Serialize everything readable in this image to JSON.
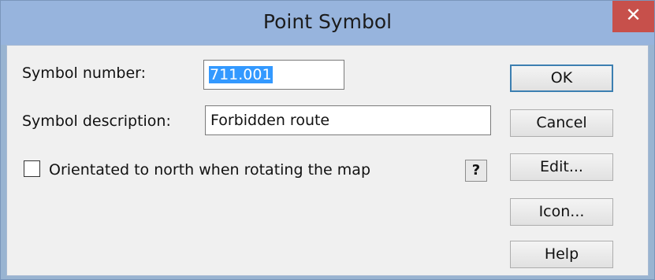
{
  "window": {
    "title": "Point Symbol",
    "close_glyph": "✕"
  },
  "form": {
    "symbol_number_label": "Symbol number:",
    "symbol_number_value": "711.001",
    "symbol_description_label": "Symbol description:",
    "symbol_description_value": "Forbidden route",
    "orientation_checkbox_label": "Orientated to north when rotating the map",
    "orientation_checked": false,
    "help_question_label": "?"
  },
  "buttons": {
    "ok": "OK",
    "cancel": "Cancel",
    "edit": "Edit...",
    "icon": "Icon...",
    "help": "Help"
  },
  "colors": {
    "titlebar": "#97b4dd",
    "close_button": "#c7504b",
    "selection": "#3399ff",
    "client_background": "#f0f0f0"
  }
}
